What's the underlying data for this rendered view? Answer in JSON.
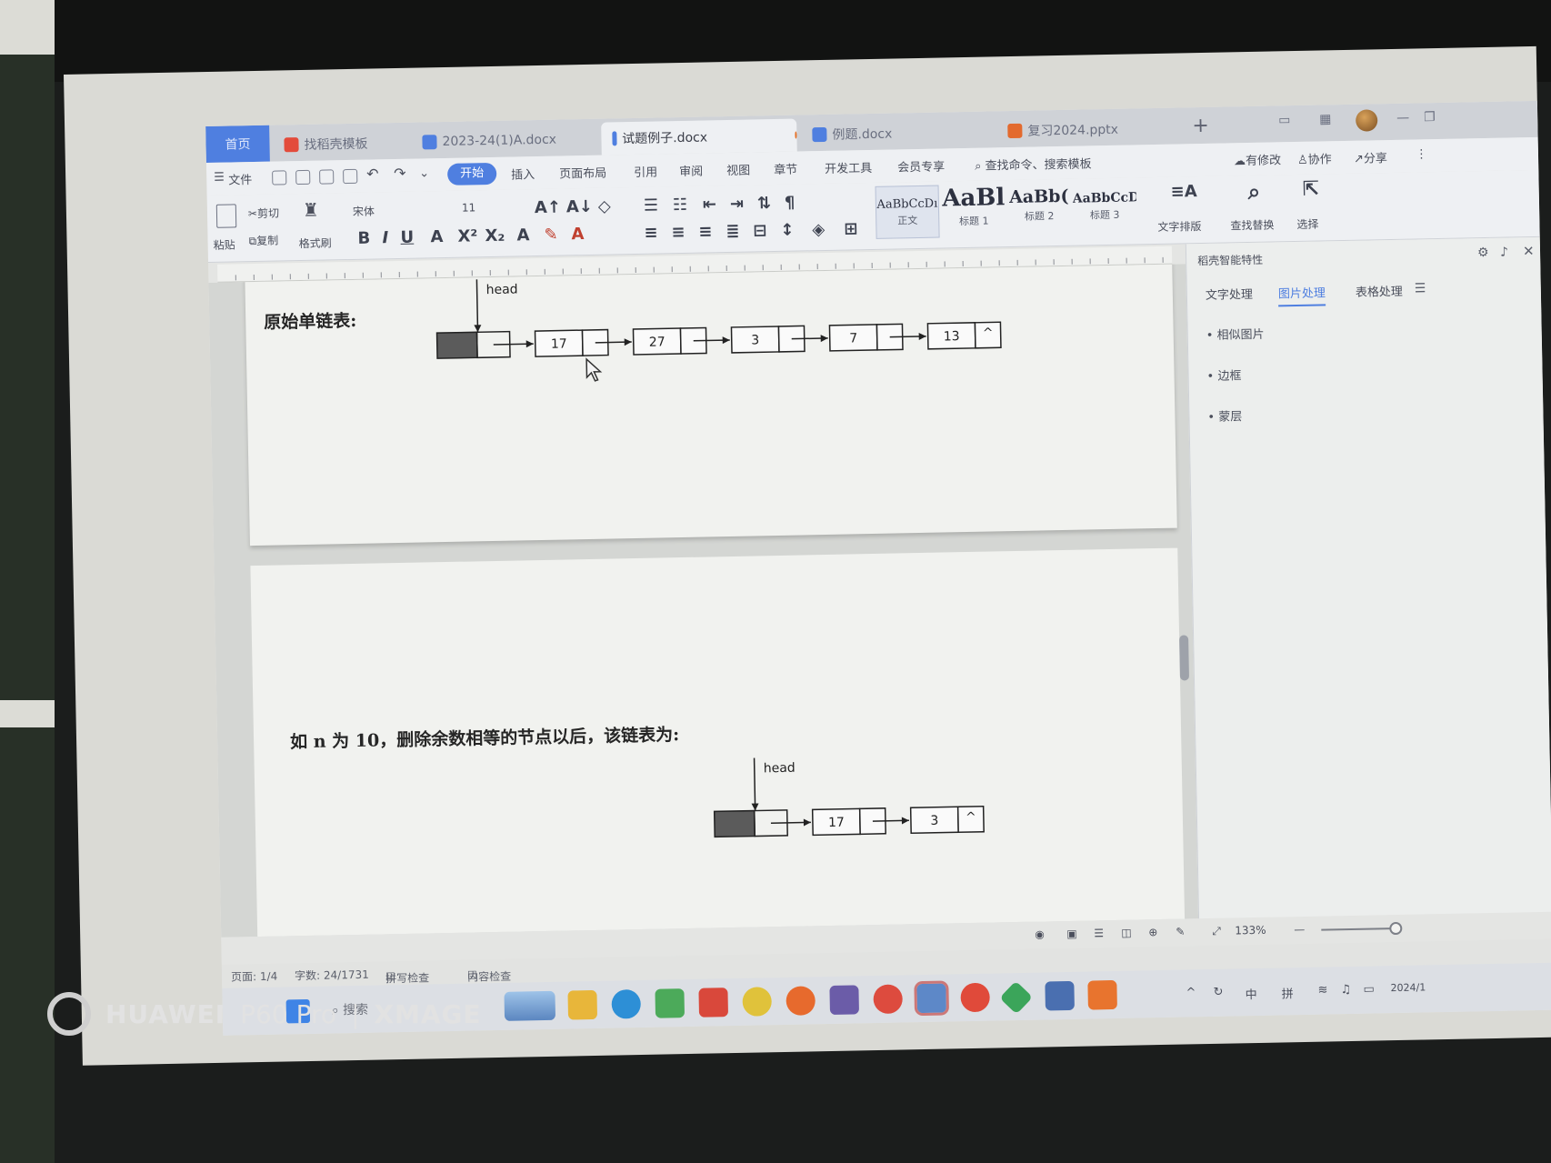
{
  "tabs": [
    {
      "label": "首页",
      "active": false
    },
    {
      "label": "找稻壳模板",
      "active": false
    },
    {
      "label": "2023-24(1)A.docx",
      "active": false
    },
    {
      "label": "试题例子.docx",
      "active": true
    },
    {
      "label": "例题.docx",
      "active": false
    },
    {
      "label": "复习2024.pptx",
      "active": false
    }
  ],
  "menu": {
    "file": "文件",
    "items": [
      "开始",
      "插入",
      "页面布局",
      "引用",
      "审阅",
      "视图",
      "章节",
      "开发工具",
      "会员专享"
    ],
    "search_placeholder": "查找命令、搜索模板",
    "right": [
      "有修改",
      "协作",
      "分享"
    ]
  },
  "ribbon": {
    "paste": "粘贴",
    "cut": "剪切",
    "copy": "复制",
    "format_painter": "格式刷",
    "font_name": "宋体",
    "font_size": "11",
    "styles": [
      {
        "preview": "AaBbCcDı",
        "label": "正文"
      },
      {
        "preview": "AaBl",
        "label": "标题 1"
      },
      {
        "preview": "AaBb(",
        "label": "标题 2"
      },
      {
        "preview": "AaBbCcDı",
        "label": "标题 3"
      }
    ],
    "text_layout": "文字排版",
    "find_replace": "查找替换",
    "select": "选择"
  },
  "document": {
    "label_original": "原始单链表:",
    "label_after": "如 n 为 10，删除余数相等的节点以后，该链表为:",
    "head_label": "head",
    "null_symbol": "^",
    "original_list": [
      "17",
      "27",
      "3",
      "7",
      "13"
    ],
    "result_list": [
      "17",
      "3"
    ]
  },
  "right_pane": {
    "title": "稻壳智能特性",
    "tabs": [
      "文字处理",
      "图片处理",
      "表格处理"
    ],
    "active_tab": "图片处理",
    "options": [
      "相似图片",
      "边框",
      "蒙层"
    ]
  },
  "viewbar": {
    "zoom": "133%"
  },
  "status": {
    "page": "页面: 1/4",
    "words": "字数: 24/1731",
    "spell": "拼写检查",
    "content_check": "内容检查"
  },
  "taskbar": {
    "search": "搜索",
    "tray": [
      "中",
      "拼"
    ],
    "date_fragment": "2024/1"
  },
  "photo_watermark": {
    "brand": "HUAWEI",
    "model": "P60 Pro",
    "separator": "|",
    "sub": "XMAGE"
  }
}
